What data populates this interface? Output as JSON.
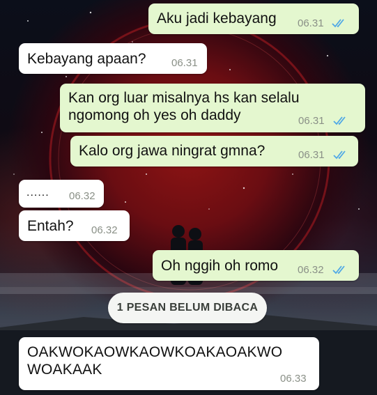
{
  "messages": [
    {
      "direction": "outgoing",
      "text": "Aku jadi kebayang",
      "time": "06.31",
      "status_icon": "double-check-icon"
    },
    {
      "direction": "incoming",
      "text": "Kebayang apaan?",
      "time": "06.31"
    },
    {
      "direction": "outgoing",
      "text": "Kan org luar misalnya hs kan selalu\nngomong oh yes oh daddy",
      "time": "06.31",
      "status_icon": "double-check-icon"
    },
    {
      "direction": "outgoing",
      "text": "Kalo org jawa ningrat gmna?",
      "time": "06.31",
      "status_icon": "double-check-icon"
    },
    {
      "direction": "incoming",
      "text": "......",
      "time": "06.32"
    },
    {
      "direction": "incoming",
      "text": "Entah?",
      "time": "06.32"
    },
    {
      "direction": "outgoing",
      "text": "Oh nggih oh romo",
      "time": "06.32",
      "status_icon": "double-check-icon"
    }
  ],
  "unread_banner": "1 PESAN BELUM DIBACA",
  "last_message": {
    "direction": "incoming",
    "text": "OAKWOKAOWKAOWKOAKAOAKWO\nWOAKAAK",
    "time": "06.33"
  },
  "colors": {
    "outgoing_bubble": "#e4f7cf",
    "incoming_bubble": "#ffffff",
    "read_ticks": "#4fa8e6",
    "timestamp": "#8a9087"
  }
}
